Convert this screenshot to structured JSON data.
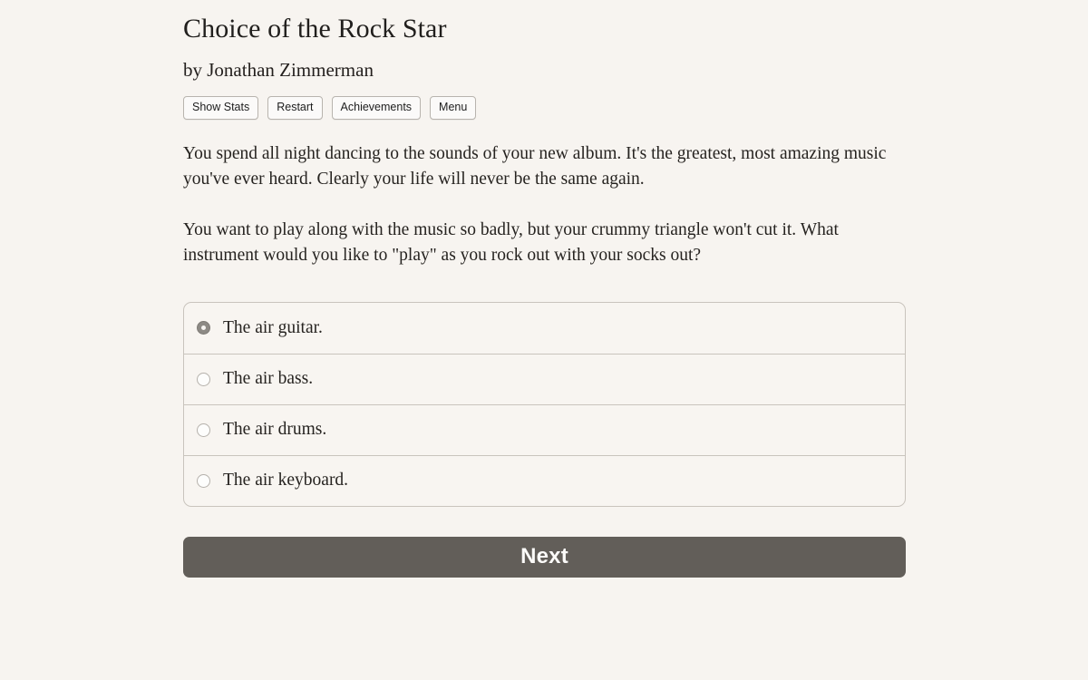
{
  "game": {
    "title": "Choice of the Rock Star",
    "byline": "by Jonathan Zimmerman"
  },
  "toolbar": {
    "buttons": [
      {
        "label": "Show Stats",
        "name": "show-stats-button"
      },
      {
        "label": "Restart",
        "name": "restart-button"
      },
      {
        "label": "Achievements",
        "name": "achievements-button"
      },
      {
        "label": "Menu",
        "name": "menu-button"
      }
    ]
  },
  "story": {
    "paragraph_1": "You spend all night dancing to the sounds of your new album. It's the greatest, most amazing music you've ever heard. Clearly your life will never be the same again.",
    "paragraph_2": "You want to play along with the music so badly, but your crummy triangle won't cut it. What instrument would you like to \"play\" as you rock out with your socks out?"
  },
  "choices": {
    "selected_index": 0,
    "options": [
      {
        "label": "The air guitar.",
        "selected": true
      },
      {
        "label": "The air bass.",
        "selected": false
      },
      {
        "label": "The air drums.",
        "selected": false
      },
      {
        "label": "The air keyboard.",
        "selected": false
      }
    ]
  },
  "actions": {
    "next_label": "Next"
  },
  "colors": {
    "page_background": "#f7f4f0",
    "text": "#262320",
    "panel_border": "#c9c4bd",
    "next_button": "#625e59",
    "radio_selected": "#8d8a85"
  }
}
